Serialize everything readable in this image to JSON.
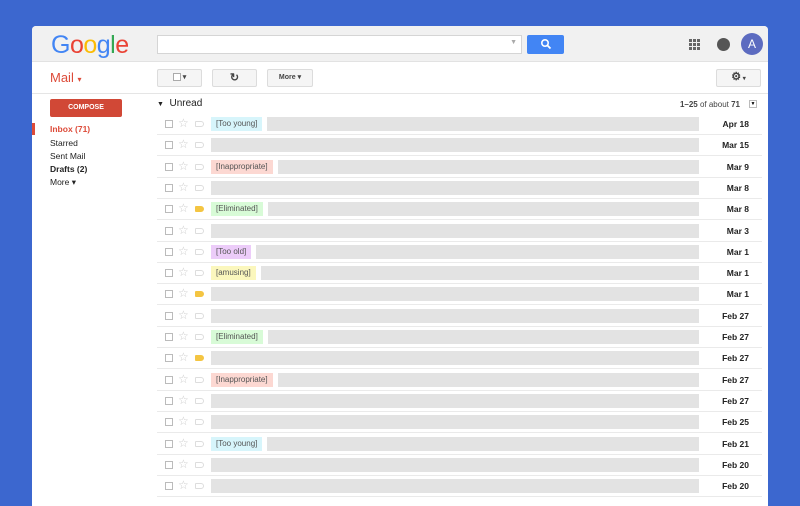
{
  "header": {
    "logo": "Google",
    "search_placeholder": "",
    "avatar_letter": "A"
  },
  "toolbar": {
    "app_label": "Mail",
    "more_label": "More",
    "accent": "#dd4b39"
  },
  "sidebar": {
    "compose": "COMPOSE",
    "items": [
      {
        "label": "Inbox (71)"
      },
      {
        "label": "Starred"
      },
      {
        "label": "Sent Mail"
      },
      {
        "label": "Drafts (2)"
      },
      {
        "label": "More ▾"
      }
    ]
  },
  "section": {
    "title": "Unread",
    "count_range": "1–25",
    "count_of": " of about ",
    "count_total": "71"
  },
  "label_colors": {
    "Too young": "#d7f5fb",
    "Inappropriate": "#fcd8d2",
    "Eliminated": "#d8fbd7",
    "Too old": "#ecccf9",
    "amusing": "#fbf7bd"
  },
  "rows": [
    {
      "label": "[Too young]",
      "color": "#d7f5fb",
      "important": false,
      "date": "Apr 18"
    },
    {
      "label": "",
      "important": false,
      "date": "Mar 15"
    },
    {
      "label": "[Inappropriate]",
      "color": "#fcd8d2",
      "important": false,
      "date": "Mar 9"
    },
    {
      "label": "",
      "important": false,
      "date": "Mar 8"
    },
    {
      "label": "[Eliminated]",
      "color": "#d8fbd7",
      "important": true,
      "date": "Mar 8"
    },
    {
      "label": "",
      "important": false,
      "date": "Mar 3"
    },
    {
      "label": "[Too old]",
      "color": "#ecccf9",
      "important": false,
      "date": "Mar 1"
    },
    {
      "label": "[amusing]",
      "color": "#fbf7bd",
      "important": false,
      "date": "Mar 1"
    },
    {
      "label": "",
      "important": true,
      "date": "Mar 1"
    },
    {
      "label": "",
      "important": false,
      "date": "Feb 27"
    },
    {
      "label": "[Eliminated]",
      "color": "#d8fbd7",
      "important": false,
      "date": "Feb 27"
    },
    {
      "label": "",
      "important": true,
      "date": "Feb 27"
    },
    {
      "label": "[Inappropriate]",
      "color": "#fcd8d2",
      "important": false,
      "date": "Feb 27"
    },
    {
      "label": "",
      "important": false,
      "date": "Feb 27"
    },
    {
      "label": "",
      "important": false,
      "date": "Feb 25"
    },
    {
      "label": "[Too young]",
      "color": "#d7f5fb",
      "important": false,
      "date": "Feb 21"
    },
    {
      "label": "",
      "important": false,
      "date": "Feb 20"
    },
    {
      "label": "",
      "important": false,
      "date": "Feb 20"
    }
  ]
}
